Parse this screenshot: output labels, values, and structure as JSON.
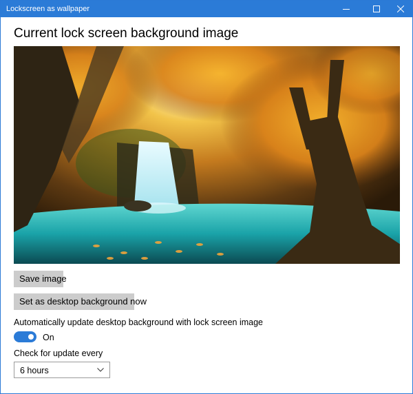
{
  "window": {
    "title": "Lockscreen as wallpaper",
    "controls": [
      "minimize-icon",
      "maximize-icon",
      "close-icon"
    ],
    "titlebar_color": "#2b7bd7"
  },
  "main": {
    "heading": "Current lock screen background image",
    "image": {
      "subject": "waterfall-forest-autumn"
    },
    "buttons": {
      "save": "Save image",
      "set_desktop": "Set as desktop background now"
    },
    "auto_update": {
      "label": "Automatically update desktop background with lock screen image",
      "toggle_state": "On",
      "toggle_on": true,
      "accent": "#2b7bd7"
    },
    "interval": {
      "label": "Check for update every",
      "selected": "6 hours"
    }
  }
}
